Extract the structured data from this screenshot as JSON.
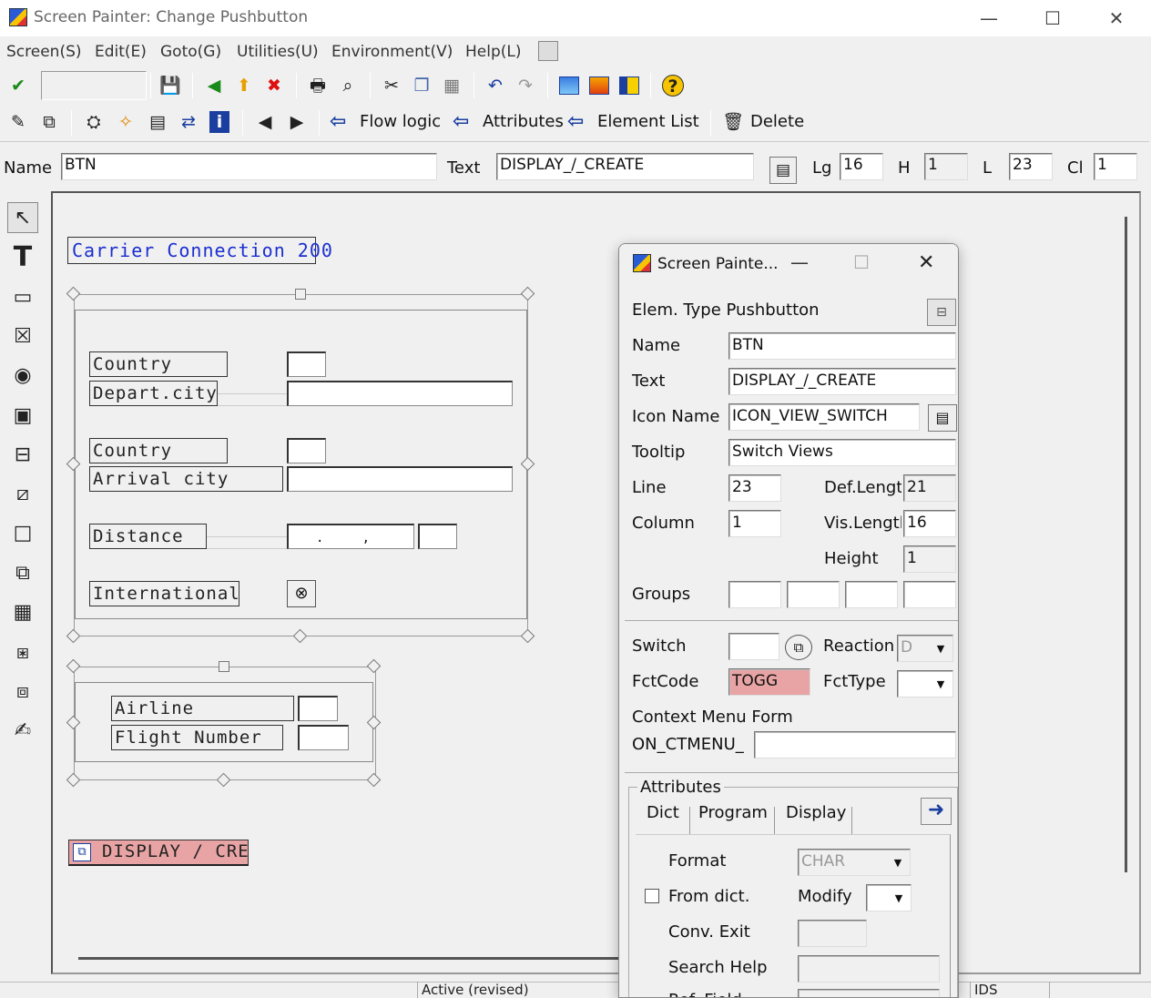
{
  "window": {
    "title": "Screen Painter:  Change Pushbutton",
    "minimize_glyph": "—",
    "maximize_glyph": "☐",
    "close_glyph": "✕"
  },
  "menu": [
    "Screen(S)",
    "Edit(E)",
    "Goto(G)",
    "Utilities(U)",
    "Environment(V)",
    "Help(L)"
  ],
  "toolbar2": {
    "flow_logic": "Flow logic",
    "attributes": "Attributes",
    "element_list": "Element List",
    "delete": "Delete"
  },
  "namebar": {
    "name_label": "Name",
    "name_value": "BTN",
    "text_label": "Text",
    "text_value": "DISPLAY_/_CREATE",
    "lg_label": "Lg",
    "lg_value": "16",
    "h_label": "H",
    "h_value": "1",
    "l_label": "L",
    "l_value": "23",
    "cl_label": "Cl",
    "cl_value": "1"
  },
  "canvas": {
    "title_label": "Carrier Connection 200",
    "country1": "Country",
    "depart_city": "Depart.city",
    "country2": "Country",
    "arrival_city": "Arrival city",
    "distance": "Distance",
    "distance_mask": ".     ,",
    "international": "International",
    "airline": "Airline",
    "flight_number": "Flight Number",
    "button_text": "DISPLAY / CRE"
  },
  "popup": {
    "title": "Screen Painte...",
    "elem_type": "Elem. Type Pushbutton",
    "name_label": "Name",
    "name_value": "BTN",
    "text_label": "Text",
    "text_value": "DISPLAY_/_CREATE",
    "icon_name_label": "Icon Name",
    "icon_name_value": "ICON_VIEW_SWITCH",
    "tooltip_label": "Tooltip",
    "tooltip_value": "Switch Views",
    "line_label": "Line",
    "line_value": "23",
    "column_label": "Column",
    "column_value": "1",
    "def_length_label": "Def.Length",
    "def_length_value": "21",
    "vis_length_label": "Vis.Length",
    "vis_length_value": "16",
    "height_label": "Height",
    "height_value": "1",
    "groups_label": "Groups",
    "switch_label": "Switch",
    "reaction_label": "Reaction",
    "reaction_value": "D",
    "fctcode_label": "FctCode",
    "fctcode_value": "TOGG",
    "fcttype_label": "FctType",
    "context_menu_label": "Context Menu Form",
    "on_ctmenu_label": "ON_CTMENU_",
    "attributes_label": "Attributes",
    "tabs": [
      "Dict",
      "Program",
      "Display"
    ],
    "format_label": "Format",
    "format_value": "CHAR",
    "from_dict_label": "From dict.",
    "modify_label": "Modify",
    "conv_exit_label": "Conv. Exit",
    "search_help_label": "Search Help",
    "ref_field_label": "Ref. Field"
  },
  "status": {
    "status_text": "Active (revised)",
    "ids_text": "IDS"
  },
  "colors": {
    "highlight": "#e8a4a4",
    "sap_blue": "#1b2fd0",
    "arrow_blue": "#1b3fa0"
  }
}
